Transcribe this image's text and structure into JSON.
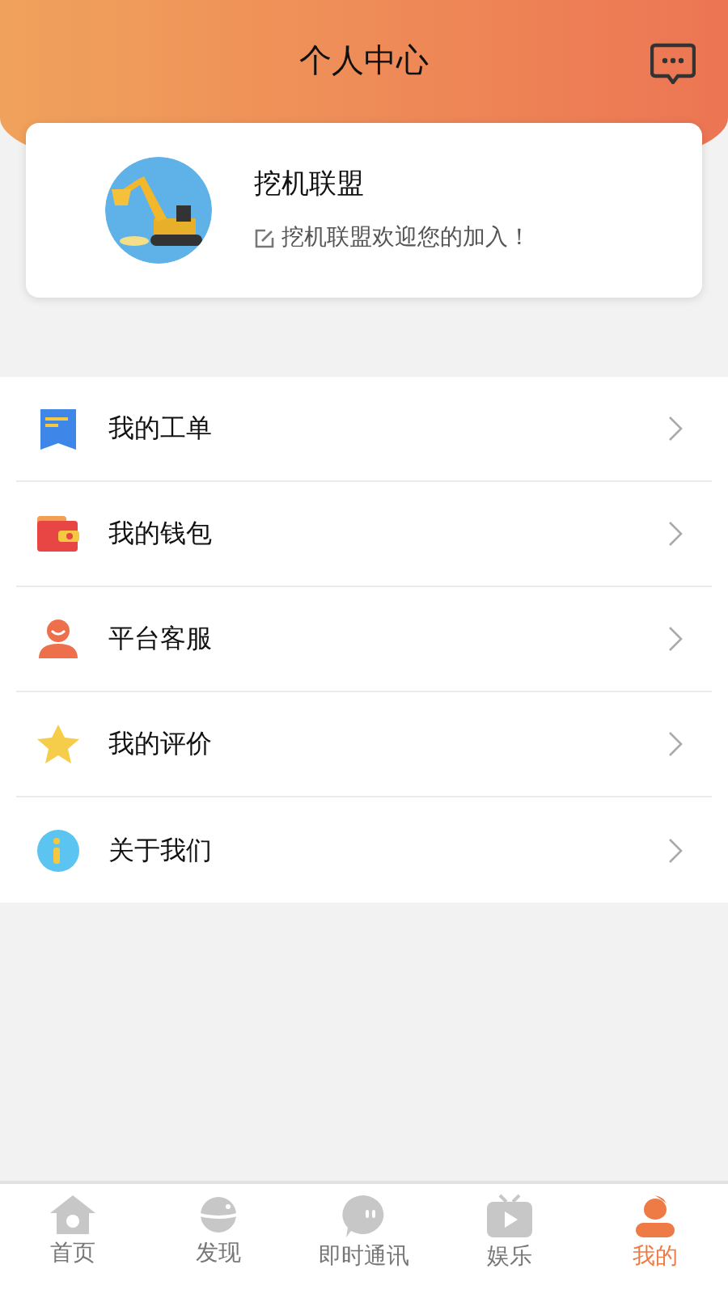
{
  "header": {
    "title": "个人中心"
  },
  "profile": {
    "name": "挖机联盟",
    "motto": "挖机联盟欢迎您的加入！"
  },
  "menu": [
    {
      "kind": "ticket",
      "label": "我的工单"
    },
    {
      "kind": "wallet",
      "label": "我的钱包"
    },
    {
      "kind": "service",
      "label": "平台客服"
    },
    {
      "kind": "star",
      "label": "我的评价"
    },
    {
      "kind": "info",
      "label": "关于我们"
    }
  ],
  "tab_bar": [
    {
      "kind": "home",
      "label": "首页",
      "selected": false
    },
    {
      "kind": "discover",
      "label": "发现",
      "selected": false
    },
    {
      "kind": "chat",
      "label": "即时通讯",
      "selected": false
    },
    {
      "kind": "video",
      "label": "娱乐",
      "selected": false
    },
    {
      "kind": "me",
      "label": "我的",
      "selected": true
    }
  ]
}
